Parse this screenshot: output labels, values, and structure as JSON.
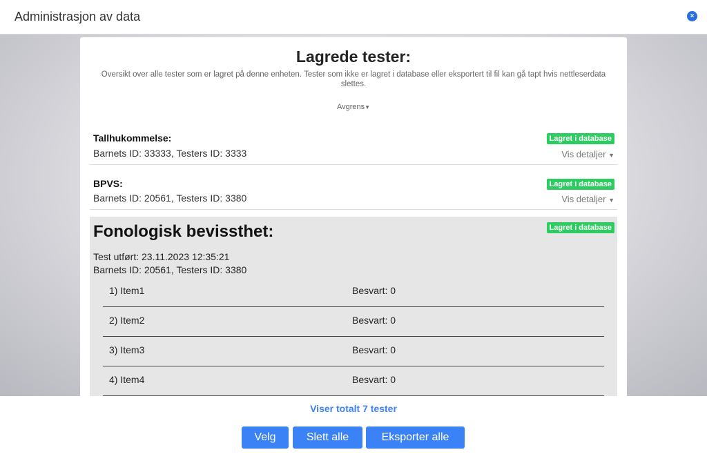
{
  "window": {
    "title": "Administrasjon av data",
    "close_symbol": "×"
  },
  "panel": {
    "title": "Lagrede tester:",
    "description": "Oversikt over alle tester som er lagret på denne enheten. Tester som ikke er lagret i database eller eksportert til fil kan gå tapt hvis nettleserdata slettes.",
    "filter_label": "Avgrens",
    "tests": [
      {
        "name": "Tallhukommelse:",
        "ids": "Barnets ID: 33333, Testers ID: 3333",
        "badge": "Lagret i database",
        "details": "Vis detaljer"
      },
      {
        "name": "BPVS:",
        "ids": "Barnets ID: 20561, Testers ID: 3380",
        "badge": "Lagret i database",
        "details": "Vis detaljer"
      }
    ],
    "expanded_test": {
      "name": "Fonologisk bevissthet:",
      "badge": "Lagret i database",
      "performed": "Test utført: 23.11.2023 12:35:21",
      "ids": "Barnets ID: 20561, Testers ID: 3380",
      "items": [
        {
          "label": "1) Item1",
          "value": "Besvart: 0"
        },
        {
          "label": "2) Item2",
          "value": "Besvart: 0"
        },
        {
          "label": "3) Item3",
          "value": "Besvart: 0"
        },
        {
          "label": "4) Item4",
          "value": "Besvart: 0"
        }
      ]
    }
  },
  "footer": {
    "total": "Viser totalt 7 tester",
    "buttons": {
      "select": "Velg",
      "delete_all": "Slett alle",
      "export_all": "Eksporter alle"
    }
  },
  "colors": {
    "accent": "#3b82f6",
    "badge": "#2ecc60",
    "close": "#2a6fdb",
    "expanded_bg": "#e6e6e6"
  }
}
